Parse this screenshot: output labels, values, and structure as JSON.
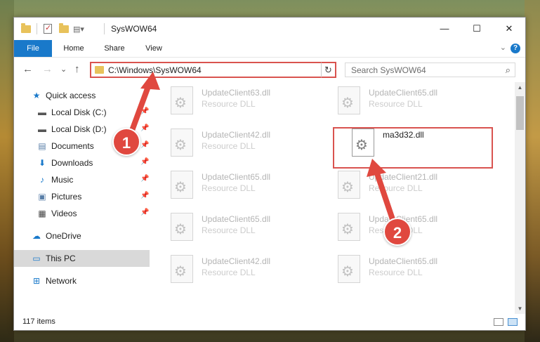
{
  "window": {
    "title": "SysWOW64",
    "controls": {
      "minimize": "—",
      "maximize": "☐",
      "close": "✕"
    }
  },
  "ribbon": {
    "tabs": [
      "File",
      "Home",
      "Share",
      "View"
    ],
    "help_label": "?"
  },
  "navigation": {
    "back": "←",
    "forward": "→",
    "recent": "⌄",
    "up": "↑",
    "address": "C:\\Windows\\SysWOW64",
    "refresh": "↻",
    "search_placeholder": "Search SysWOW64"
  },
  "sidebar": {
    "items": [
      {
        "label": "Quick access",
        "icon": "star-icon",
        "pinned": false
      },
      {
        "label": "Local Disk (C:)",
        "icon": "drive-icon",
        "pinned": true
      },
      {
        "label": "Local Disk (D:)",
        "icon": "drive-icon",
        "pinned": true
      },
      {
        "label": "Documents",
        "icon": "documents-icon",
        "pinned": true
      },
      {
        "label": "Downloads",
        "icon": "download-icon",
        "pinned": true
      },
      {
        "label": "Music",
        "icon": "music-icon",
        "pinned": true
      },
      {
        "label": "Pictures",
        "icon": "pictures-icon",
        "pinned": true
      },
      {
        "label": "Videos",
        "icon": "videos-icon",
        "pinned": true
      },
      {
        "label": "OneDrive",
        "icon": "cloud-icon",
        "pinned": false
      },
      {
        "label": "This PC",
        "icon": "computer-icon",
        "pinned": false,
        "selected": true
      },
      {
        "label": "Network",
        "icon": "network-icon",
        "pinned": false
      }
    ]
  },
  "files": {
    "left_column": [
      {
        "name": "UpdateClient63.dll",
        "type": "Resource DLL"
      },
      {
        "name": "UpdateClient42.dll",
        "type": "Resource DLL"
      },
      {
        "name": "UpdateClient65.dll",
        "type": "Resource DLL"
      },
      {
        "name": "UpdateClient65.dll",
        "type": "Resource DLL"
      },
      {
        "name": "UpdateClient42.dll",
        "type": "Resource DLL"
      }
    ],
    "right_column": [
      {
        "name": "UpdateClient65.dll",
        "type": "Resource DLL"
      },
      {
        "name": "ma3d32.dll",
        "type": "",
        "highlighted": true
      },
      {
        "name": "UpdateClient21.dll",
        "type": "Resource DLL"
      },
      {
        "name": "UpdateClient65.dll",
        "type": "Resource DLL"
      },
      {
        "name": "UpdateClient65.dll",
        "type": "Resource DLL"
      }
    ]
  },
  "status": {
    "item_count": "117 items"
  },
  "annotations": {
    "badge_1": "1",
    "badge_2": "2",
    "accent_color": "#e0483f"
  }
}
